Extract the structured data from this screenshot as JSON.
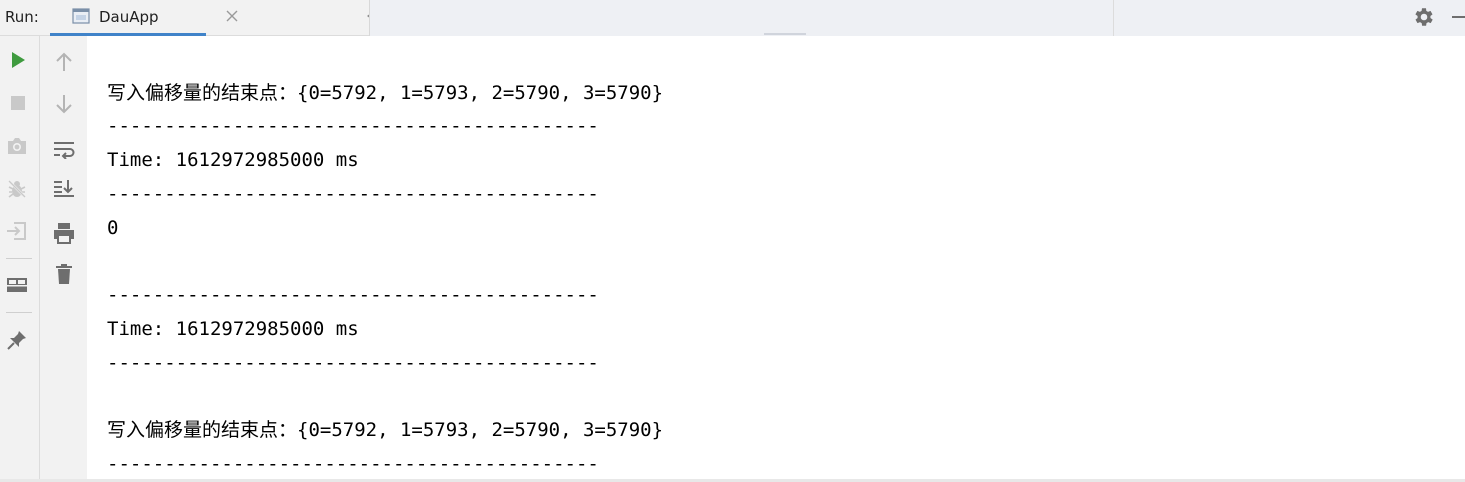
{
  "run_panel": {
    "label": "Run:",
    "tab": {
      "title": "DauApp",
      "icon": "console-window-icon",
      "close_icon": "close-icon"
    },
    "header_actions": {
      "settings_icon": "gear-icon",
      "minimize_icon": "minimize-icon"
    }
  },
  "toolbar_primary": [
    {
      "id": "rerun",
      "icon": "play-icon",
      "color": "#3f9b3f"
    },
    {
      "id": "stop",
      "icon": "stop-icon",
      "color": "#c9c9c9"
    },
    {
      "id": "dump-threads",
      "icon": "camera-icon",
      "color": "#c9c9c9"
    },
    {
      "id": "mute-breakpoints",
      "icon": "bug-off-icon",
      "color": "#c9c9c9"
    },
    {
      "id": "exit",
      "icon": "exit-icon",
      "color": "#c9c9c9"
    },
    {
      "id": "layout",
      "icon": "layout-icon",
      "color": "#6e6e6e"
    },
    {
      "id": "pin",
      "icon": "pin-icon",
      "color": "#6e6e6e"
    }
  ],
  "toolbar_secondary": [
    {
      "id": "up",
      "icon": "arrow-up-icon",
      "color": "#b4b4b4"
    },
    {
      "id": "down",
      "icon": "arrow-down-icon",
      "color": "#b4b4b4"
    },
    {
      "id": "soft-wrap",
      "icon": "soft-wrap-icon",
      "color": "#6e6e6e"
    },
    {
      "id": "scroll-to-end",
      "icon": "scroll-to-end-icon",
      "color": "#6e6e6e"
    },
    {
      "id": "print",
      "icon": "print-icon",
      "color": "#6e6e6e"
    },
    {
      "id": "clear",
      "icon": "trash-icon",
      "color": "#6e6e6e"
    }
  ],
  "console": {
    "lines": [
      "写入偏移量的结束点：{0=5792, 1=5793, 2=5790, 3=5790}",
      "-------------------------------------------",
      "Time: 1612972985000 ms",
      "-------------------------------------------",
      "0",
      "",
      "-------------------------------------------",
      "Time: 1612972985000 ms",
      "-------------------------------------------",
      "",
      "写入偏移量的结束点：{0=5792, 1=5793, 2=5790, 3=5790}",
      "-------------------------------------------"
    ]
  },
  "colors": {
    "accent": "#4083c9",
    "toolbar_bg": "#f2f2f2",
    "console_bg": "#ffffff",
    "text": "#000000"
  }
}
